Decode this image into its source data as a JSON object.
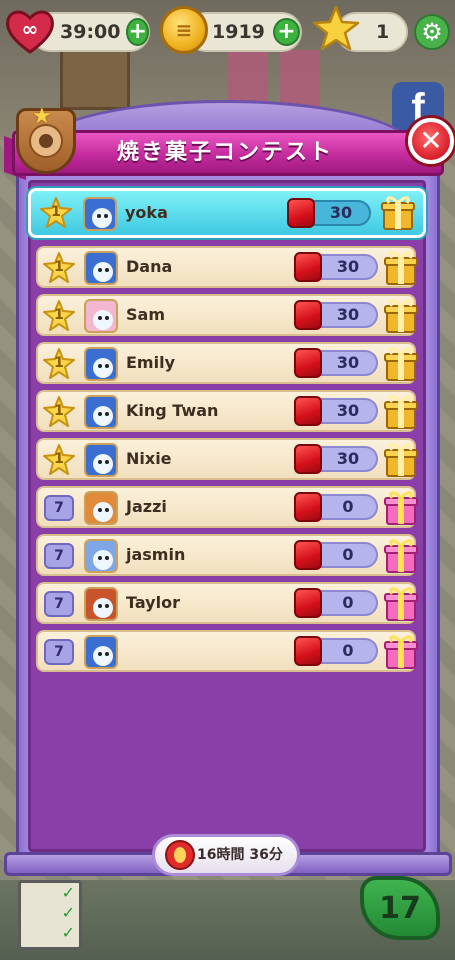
{
  "hud": {
    "lives_timer": "39:00",
    "coins": "1919",
    "stars": "1"
  },
  "dialog": {
    "title": "焼き菓子コンテスト",
    "timer": "16時間 36分"
  },
  "rows": [
    {
      "rank": "1",
      "name": "yoka",
      "score": "30",
      "is_me": true,
      "rank_type": "star",
      "gift": "gold"
    },
    {
      "rank": "1",
      "name": "Dana",
      "score": "30",
      "rank_type": "star",
      "gift": "gold"
    },
    {
      "rank": "1",
      "name": "Sam",
      "score": "30",
      "rank_type": "star",
      "gift": "gold"
    },
    {
      "rank": "1",
      "name": "Emily",
      "score": "30",
      "rank_type": "star",
      "gift": "gold"
    },
    {
      "rank": "1",
      "name": "King Twan",
      "score": "30",
      "rank_type": "star",
      "gift": "gold"
    },
    {
      "rank": "1",
      "name": "Nixie",
      "score": "30",
      "rank_type": "star",
      "gift": "gold"
    },
    {
      "rank": "7",
      "name": "Jazzi",
      "score": "0",
      "rank_type": "box",
      "gift": "pink"
    },
    {
      "rank": "7",
      "name": "jasmin",
      "score": "0",
      "rank_type": "box",
      "gift": "pink"
    },
    {
      "rank": "7",
      "name": "Taylor",
      "score": "0",
      "rank_type": "box",
      "gift": "pink"
    },
    {
      "rank": "7",
      "name": "",
      "score": "0",
      "rank_type": "box",
      "gift": "pink"
    }
  ],
  "background": {
    "level_number": "17",
    "facebook_letter": "f"
  },
  "colors": {
    "accent_pink": "#c42b9d",
    "panel_purple": "#8a3fa8",
    "highlight_cyan": "#3fc9e1"
  }
}
